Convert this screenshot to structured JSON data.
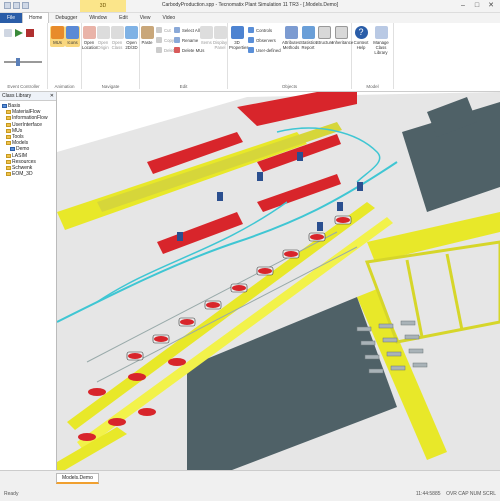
{
  "window": {
    "title": "CarbodyProduction.spp - Tecnomatix Plant Simulation 11 TR3 - [.Models.Demo]",
    "context_tab": "3D",
    "min_glyph": "–",
    "max_glyph": "□",
    "close_glyph": "✕"
  },
  "tabs": [
    "File",
    "Home",
    "Debugger",
    "Window",
    "Edit",
    "View",
    "Video"
  ],
  "active_tab": "Home",
  "ribbon": {
    "event_controller": {
      "label": "Event Controller"
    },
    "animation": {
      "label": "Animation",
      "mus_label": "MUs",
      "icons_label": "Icons"
    },
    "navigate": {
      "label": "Navigate",
      "buttons": [
        "Open Location",
        "Open Origin",
        "Open Class",
        "Open 2D/3D"
      ]
    },
    "edit": {
      "label": "Edit",
      "paste_label": "Paste",
      "small": [
        "Cut",
        "Copy",
        "Delete",
        "Select All",
        "Rename",
        "Delete MUs",
        "Items",
        "Display Panel"
      ]
    },
    "objects": {
      "label": "Objects",
      "buttons": [
        "3D Properties",
        "Attributes Methods",
        "Statistics Report",
        "Structure",
        "Inheritance",
        "Context Help",
        "Manage Class Library"
      ],
      "small": [
        "Controls",
        "Observers",
        "User-defined"
      ]
    },
    "model": {
      "label": "Model"
    }
  },
  "class_library": {
    "title": "Class Library",
    "close_glyph": "✕",
    "items": [
      {
        "label": "Basis",
        "level": 0,
        "blue": true
      },
      {
        "label": "MaterialFlow",
        "level": 1,
        "blue": false
      },
      {
        "label": "InformationFlow",
        "level": 1,
        "blue": false
      },
      {
        "label": "UserInterface",
        "level": 1,
        "blue": false
      },
      {
        "label": "MUs",
        "level": 1,
        "blue": false
      },
      {
        "label": "Tools",
        "level": 1,
        "blue": false
      },
      {
        "label": "Models",
        "level": 1,
        "blue": false
      },
      {
        "label": "Demo",
        "level": 2,
        "blue": true
      },
      {
        "label": "LASIM",
        "level": 1,
        "blue": false
      },
      {
        "label": "Resources",
        "level": 1,
        "blue": false
      },
      {
        "label": "Schwenk",
        "level": 1,
        "blue": false
      },
      {
        "label": "EOM_3D",
        "level": 1,
        "blue": false
      }
    ]
  },
  "document_tab": "Models.Demo",
  "status": {
    "left": "Ready",
    "time": "11:44:5885",
    "right": "OVR CAP NUM SCRL"
  },
  "colors": {
    "accent": "#2a5da8",
    "context": "#fbe58a",
    "conveyor_yellow": "#e8e829",
    "car_red": "#d8252b",
    "floor": "#e8e8e8",
    "building": "#4f6167"
  }
}
